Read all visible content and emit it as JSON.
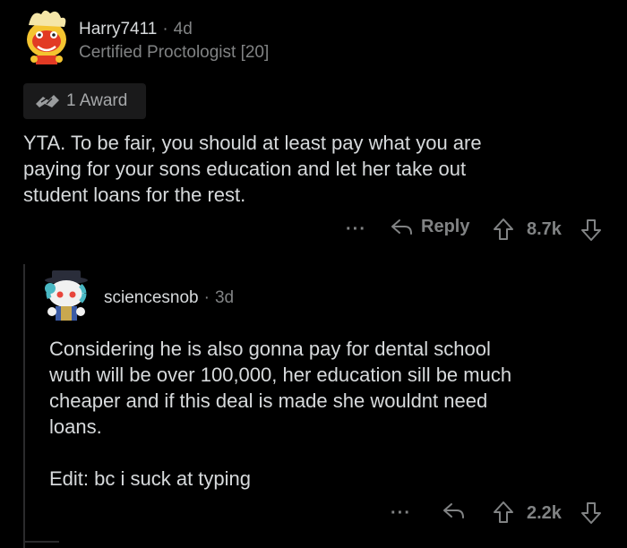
{
  "comment": {
    "username": "Harry7411",
    "separator": "·",
    "age": "4d",
    "flair": "Certified Proctologist [20]",
    "award_label": "1 Award",
    "body_lines": [
      "YTA.  To be fair, you should at least pay what you are",
      "paying for your sons education and let her take out",
      "student loans for the rest."
    ],
    "more": "···",
    "reply_label": "Reply",
    "score": "8.7k"
  },
  "reply": {
    "username": "sciencesnob",
    "separator": "·",
    "age": "3d",
    "body_lines": [
      "Considering he is also gonna pay for dental school",
      "wuth will be over 100,000, her education sill be much",
      "cheaper and if this deal is made she wouldnt need",
      "loans."
    ],
    "edit_line": "Edit: bc i suck at typing",
    "more": "···",
    "score": "2.2k"
  },
  "colors": {
    "background": "#000000",
    "text": "#d7dadc",
    "meta": "#818384",
    "award_bg": "#1a1a1b"
  },
  "icons": {
    "award": "award-hands-icon",
    "reply": "reply-arrow-icon",
    "upvote": "upvote-arrow-icon",
    "downvote": "downvote-arrow-icon",
    "more": "more-options-icon"
  }
}
